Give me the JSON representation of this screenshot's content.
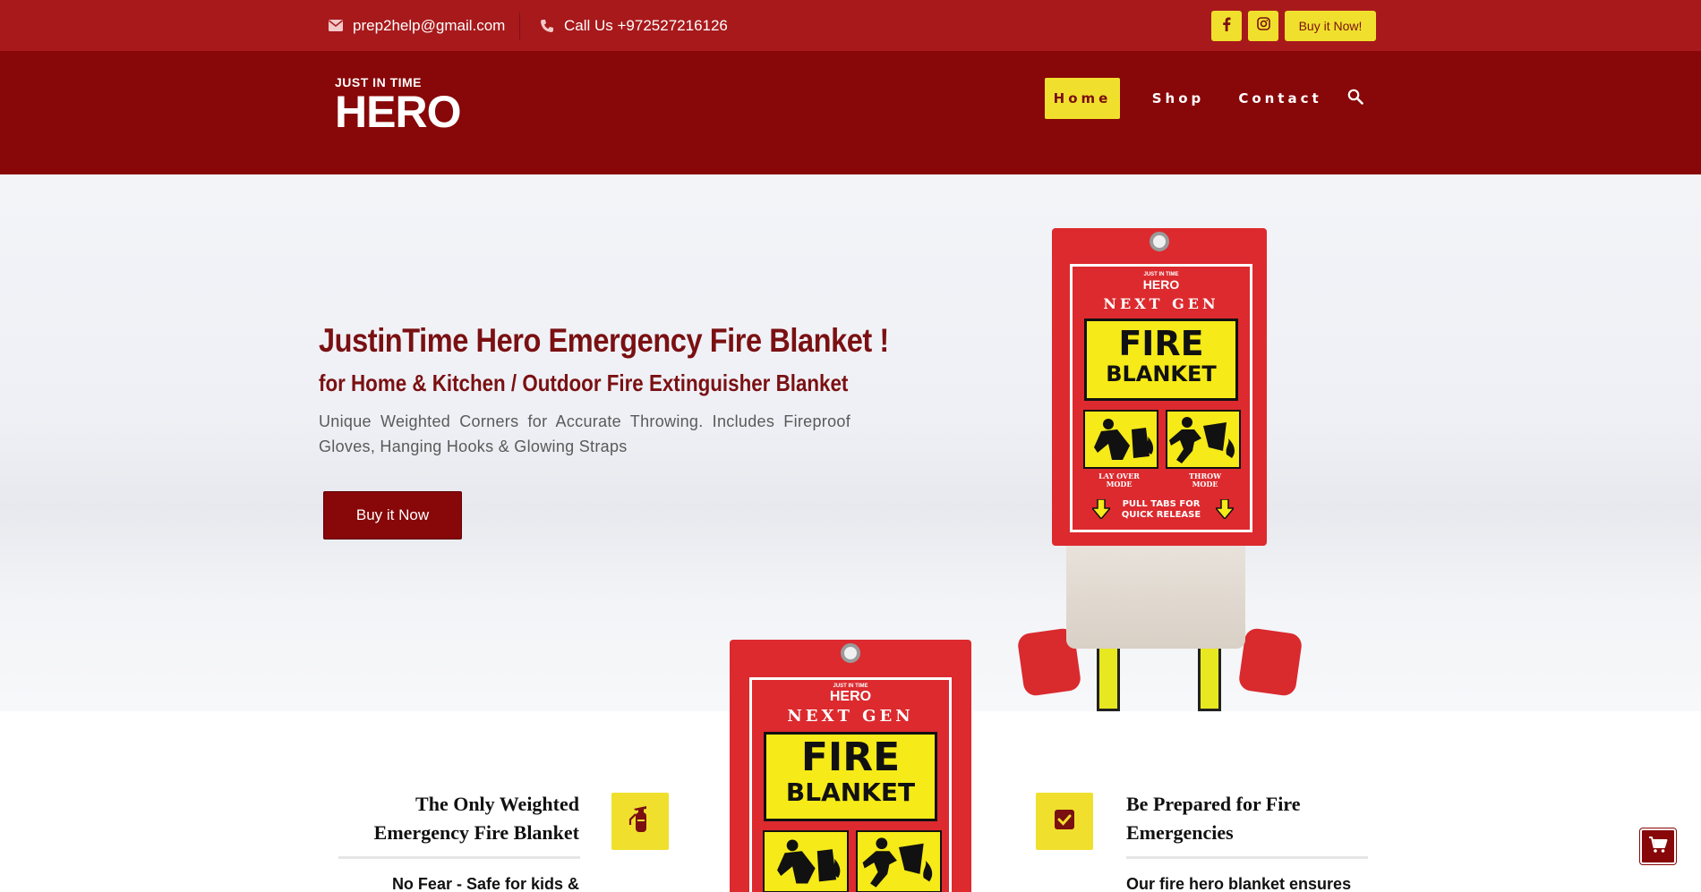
{
  "topbar": {
    "email": "prep2help@gmail.com",
    "phone": "Call Us +972527216126",
    "buy_label": "Buy it Now!"
  },
  "header": {
    "logo_small": "JUST IN TIME",
    "logo_big": "HERO",
    "nav": [
      "Home",
      "Shop",
      "Contact"
    ]
  },
  "hero": {
    "title": "JustinTime Hero Emergency Fire Blanket !",
    "subtitle": "for Home & Kitchen / Outdoor Fire Extinguisher Blanket",
    "description": "Unique Weighted Corners for Accurate Throwing. Includes Fireproof Gloves, Hanging Hooks & Glowing Straps",
    "button": "Buy it Now"
  },
  "product": {
    "logo_small": "JUST IN TIME",
    "logo_big": "HERO",
    "next_gen": "NEXT GEN",
    "fire": "FIRE",
    "blanket": "BLANKET",
    "mode_lay": "LAY OVER MODE",
    "mode_throw": "THROW MODE",
    "pull_line1": "PULL TABS FOR",
    "pull_line2": "QUICK RELEASE"
  },
  "features": {
    "left_title_1": "The Only Weighted",
    "left_title_2": "Emergency Fire Blanket",
    "left_text": "No Fear - Safe for kids &",
    "right_title_1": "Be Prepared for Fire",
    "right_title_2": "Emergencies",
    "right_text": "Our fire hero blanket ensures"
  },
  "icons": {
    "email": "envelope-icon",
    "phone": "phone-icon",
    "facebook": "facebook-icon",
    "instagram": "instagram-icon",
    "search": "search-icon",
    "extinguisher": "fire-extinguisher-icon",
    "check": "checkbox-icon",
    "cart": "cart-icon"
  },
  "colors": {
    "topbar": "#a8191b",
    "header": "#880709",
    "accent_yellow": "#f0e02d",
    "title_red": "#7a1012"
  }
}
